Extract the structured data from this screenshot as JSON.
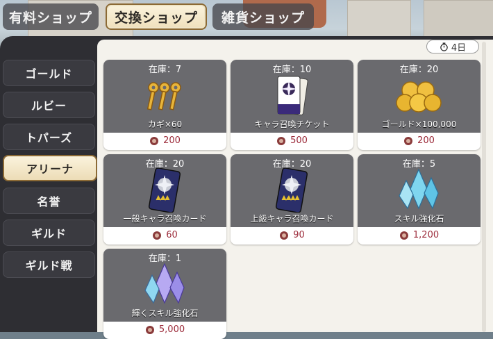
{
  "tabs": [
    {
      "label": "有料ショップ",
      "active": false
    },
    {
      "label": "交換ショップ",
      "active": true
    },
    {
      "label": "雑貨ショップ",
      "active": false
    }
  ],
  "sidebar": {
    "items": [
      {
        "label": "ゴールド",
        "active": false
      },
      {
        "label": "ルビー",
        "active": false
      },
      {
        "label": "トパーズ",
        "active": false
      },
      {
        "label": "アリーナ",
        "active": true
      },
      {
        "label": "名誉",
        "active": false
      },
      {
        "label": "ギルド",
        "active": false
      },
      {
        "label": "ギルド戦",
        "active": false
      }
    ]
  },
  "timer": {
    "icon": "stopwatch-icon",
    "label": "4日"
  },
  "items": [
    {
      "stock": "在庫：7",
      "name": "カギ×60",
      "price": "200",
      "icon": "keys-icon"
    },
    {
      "stock": "在庫：10",
      "name": "キャラ召喚チケット",
      "price": "500",
      "icon": "summon-ticket-icon"
    },
    {
      "stock": "在庫：20",
      "name": "ゴールド×100,000",
      "price": "200",
      "icon": "gold-coins-icon"
    },
    {
      "stock": "在庫：20",
      "name": "一般キャラ召喚カード",
      "price": "60",
      "icon": "summon-card-icon"
    },
    {
      "stock": "在庫：20",
      "name": "上級キャラ召喚カード",
      "price": "90",
      "icon": "summon-card-icon"
    },
    {
      "stock": "在庫：5",
      "name": "スキル強化石",
      "price": "1,200",
      "icon": "crystal-icon"
    },
    {
      "stock": "在庫：1",
      "name": "輝くスキル強化石",
      "price": "5,000",
      "icon": "crystal-icon"
    }
  ],
  "colors": {
    "price": "#9c2b3a",
    "card_header": "#6a6a6e",
    "panel": "#f4f2ec",
    "frame": "#2e2e33",
    "active_tab": "#efe0bc"
  }
}
